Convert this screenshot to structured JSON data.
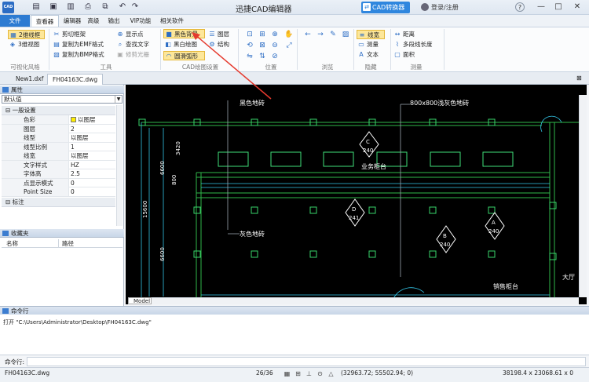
{
  "app": {
    "title": "迅捷CAD编辑器",
    "icon_text": "CAD"
  },
  "titlebar": {
    "convert_label": "CAD转换器",
    "login_label": "登录/注册",
    "min": "—",
    "max": "□",
    "close": "✕",
    "help": "?"
  },
  "tabs": [
    "文件",
    "查看器",
    "编辑器",
    "高级",
    "输出",
    "VIP功能",
    "相关软件"
  ],
  "ribbon": {
    "view_buttons": [
      "2维线框",
      "3维视图"
    ],
    "tools": [
      "剪切框架",
      "复制为EMF格式",
      "复制为BMP格式",
      "显示点",
      "查找文字",
      "修剪光栅"
    ],
    "cad_settings": [
      "黑色背景",
      "黑白绘图",
      "圆滑弧形",
      "图层",
      "结构"
    ],
    "hidden_items": [
      "线宽",
      "测量",
      "文本"
    ],
    "measure_items": [
      "距离",
      "多段线长度",
      "面积"
    ],
    "groups": [
      "可视化风格",
      "工具",
      "CAD绘图设置",
      "位置",
      "浏览",
      "隐藏",
      "测量"
    ]
  },
  "doc_tabs": [
    "New1.dxf",
    "FH04163C.dwg"
  ],
  "properties": {
    "title": "属性",
    "selected": "默认值",
    "cat_general": "一般设置",
    "rows": [
      {
        "k": "色彩",
        "v": "以图层"
      },
      {
        "k": "图层",
        "v": "2"
      },
      {
        "k": "线型",
        "v": "以图层"
      },
      {
        "k": "线型比例",
        "v": "1"
      },
      {
        "k": "线宽",
        "v": "以图层"
      },
      {
        "k": "文字样式",
        "v": "HZ"
      },
      {
        "k": "字体高",
        "v": "2.5"
      },
      {
        "k": "点显示模式",
        "v": "0"
      },
      {
        "k": "Point Size",
        "v": "0"
      }
    ],
    "cat_dim": "标注"
  },
  "favorites": {
    "title": "收藏夹",
    "col_name": "名称",
    "col_path": "路径"
  },
  "drawing": {
    "labels": {
      "black_tile": "黑色地砖",
      "grey_tile_800": "800x800浅灰色地砖",
      "grey_tile": "灰色地砖",
      "counter": "业务柜台",
      "sales_counter": "销售柜台",
      "hall": "大厅",
      "dim_6600a": "6600",
      "dim_3420": "3420",
      "dim_800": "800",
      "dim_15600": "15600",
      "dim_6600b": "6600",
      "sym_c": "C",
      "sym_c_n": "240",
      "sym_d": "D",
      "sym_d_n": "241",
      "sym_b": "B",
      "sym_b_n": "240",
      "sym_a": "A",
      "sym_a_n": "240"
    }
  },
  "model_tab": "Model",
  "command": {
    "title": "命令行",
    "history": "打开 \"C:\\Users\\Administrator\\Desktop\\FH04163C.dwg\"",
    "input_label": "命令行:"
  },
  "status": {
    "file": "FH04163C.dwg",
    "page": "26/36",
    "coords": "(32963.72; 55502.94; 0)",
    "size": "38198.4 x 23068.61 x 0"
  }
}
